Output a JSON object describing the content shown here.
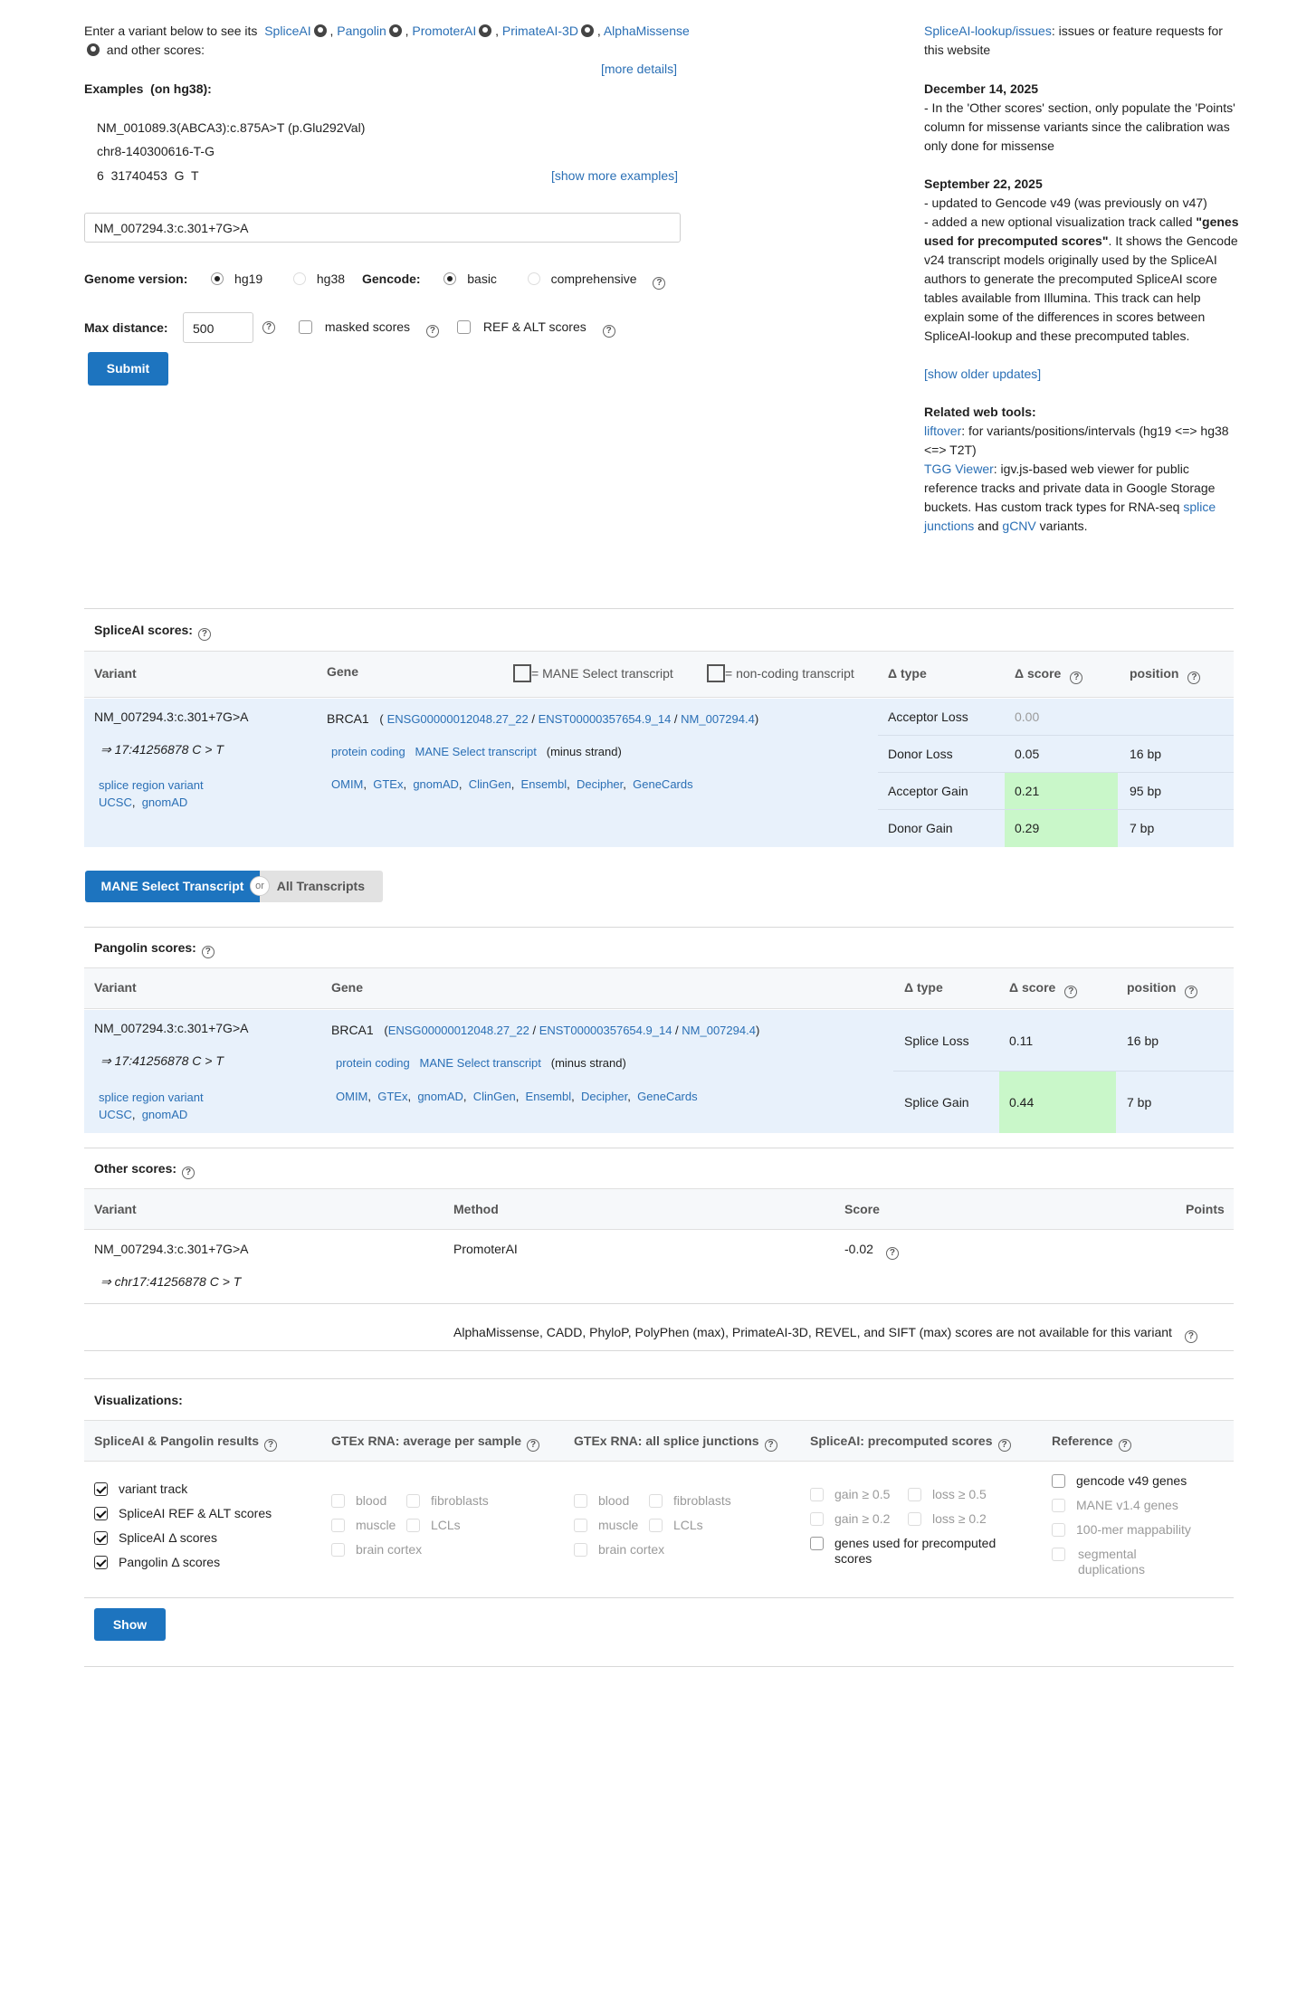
{
  "intro": {
    "prefix": "Enter a variant below to see its",
    "tools": [
      "SpliceAI",
      "Pangolin",
      "PromoterAI",
      "PrimateAI-3D",
      "AlphaMissense"
    ],
    "suffix": "and other scores:",
    "more_details": "[more details]"
  },
  "examples": {
    "heading": "Examples",
    "assembly": "(on hg38):",
    "items": [
      "NM_001089.3(ABCA3):c.875A>T (p.Glu292Val)",
      "chr8-140300616-T-G",
      "6  31740453  G  T"
    ],
    "show_more": "[show more examples]"
  },
  "search": {
    "value": "NM_007294.3:c.301+7G>A"
  },
  "options": {
    "genome_label": "Genome version:",
    "genome_options": [
      "hg19",
      "hg38"
    ],
    "genome_selected": "hg19",
    "gencode_label": "Gencode:",
    "gencode_options": [
      "basic",
      "comprehensive"
    ],
    "gencode_selected": "basic",
    "max_distance_label": "Max distance:",
    "max_distance_value": "500",
    "masked_label": "masked scores",
    "refalt_label": "REF & ALT scores",
    "submit_label": "Submit"
  },
  "news": {
    "issues_link": "SpliceAI-lookup/issues",
    "issues_text": ": issues or feature requests for this website",
    "updates": [
      {
        "date": "December 14, 2025",
        "lines": [
          "- In the 'Other scores' section, only populate the 'Points' column for missense variants since the calibration was only done for missense"
        ]
      },
      {
        "date": "September 22, 2025",
        "lines": [
          "- updated to Gencode v49 (was previously on v47)",
          "- added a new optional visualization track called"
        ],
        "bold": "\"genes used for precomputed scores\"",
        "after_bold": ". It shows the Gencode v24 transcript models originally used by the SpliceAI authors to generate the precomputed SpliceAI score tables available from Illumina. This track can help explain some of the differences in scores between SpliceAI-lookup and these precomputed tables."
      }
    ],
    "show_older": "[show older updates]",
    "related_heading": "Related web tools:",
    "liftover_link": "liftover",
    "liftover_text": ": for variants/positions/intervals (hg19 <=> hg38 <=> T2T)",
    "tgg_link": "TGG Viewer",
    "tgg_text": ": igv.js-based web viewer for public reference tracks and private data in Google Storage buckets. Has custom track types for RNA-seq",
    "splice_link": "splice junctions",
    "and_text": "and",
    "gcnv_link": "gCNV",
    "variants_text": "variants."
  },
  "spliceai": {
    "title": "SpliceAI scores:",
    "headers": {
      "variant": "Variant",
      "gene": "Gene",
      "mane_legend": "= MANE Select transcript",
      "noncoding_legend": "= non-coding transcript",
      "dtype": "Δ type",
      "dscore": "Δ score",
      "position": "position"
    },
    "variant": "NM_007294.3:c.301+7G>A",
    "coord": "⇒ 17:41256878 C > T",
    "consequence": "splice region variant",
    "ucsc": "UCSC",
    "gnomad": "gnomAD",
    "gene": "BRCA1",
    "ensg": "ENSG00000012048.27_22",
    "enst": "ENST00000357654.9_14",
    "nm": "NM_007294.4",
    "biotype": "protein coding",
    "mane": "MANE Select transcript",
    "strand": "(minus strand)",
    "gene_links": [
      "OMIM",
      "GTEx",
      "gnomAD",
      "ClinGen",
      "Ensembl",
      "Decipher",
      "GeneCards"
    ],
    "rows": [
      {
        "type": "Acceptor Loss",
        "score": "0.00",
        "position": ""
      },
      {
        "type": "Donor Loss",
        "score": "0.05",
        "position": "16 bp"
      },
      {
        "type": "Acceptor Gain",
        "score": "0.21",
        "position": "95 bp"
      },
      {
        "type": "Donor Gain",
        "score": "0.29",
        "position": "7 bp"
      }
    ]
  },
  "toggle": {
    "mane": "MANE Select Transcript",
    "or": "or",
    "all": "All Transcripts"
  },
  "pangolin": {
    "title": "Pangolin scores:",
    "headers": {
      "variant": "Variant",
      "gene": "Gene",
      "dtype": "Δ type",
      "dscore": "Δ score",
      "position": "position"
    },
    "variant": "NM_007294.3:c.301+7G>A",
    "coord": "⇒ 17:41256878 C > T",
    "consequence": "splice region variant",
    "ucsc": "UCSC",
    "gnomad": "gnomAD",
    "gene": "BRCA1",
    "ensg": "ENSG00000012048.27_22",
    "enst": "ENST00000357654.9_14",
    "nm": "NM_007294.4",
    "biotype": "protein coding",
    "mane": "MANE Select transcript",
    "strand": "(minus strand)",
    "gene_links": [
      "OMIM",
      "GTEx",
      "gnomAD",
      "ClinGen",
      "Ensembl",
      "Decipher",
      "GeneCards"
    ],
    "rows": [
      {
        "type": "Splice Loss",
        "score": "0.11",
        "position": "16 bp"
      },
      {
        "type": "Splice Gain",
        "score": "0.44",
        "position": "7 bp"
      }
    ]
  },
  "other": {
    "title": "Other scores:",
    "headers": {
      "variant": "Variant",
      "method": "Method",
      "score": "Score",
      "points": "Points"
    },
    "variant": "NM_007294.3:c.301+7G>A",
    "coord": "⇒ chr17:41256878 C > T",
    "method": "PromoterAI",
    "score": "-0.02",
    "unavailable": "AlphaMissense,  CADD,  PhyloP,  PolyPhen (max),  PrimateAI-3D,  REVEL,  and SIFT (max) scores are not available for this variant"
  },
  "viz": {
    "title": "Visualizations:",
    "col1": {
      "title": "SpliceAI & Pangolin results",
      "items": [
        "variant track",
        "SpliceAI REF & ALT scores",
        "SpliceAI Δ  scores",
        "Pangolin Δ  scores"
      ]
    },
    "col2": {
      "title": "GTEx RNA: average per sample",
      "items": [
        "blood",
        "fibroblasts",
        "muscle",
        "LCLs",
        "brain cortex"
      ]
    },
    "col3": {
      "title": "GTEx RNA: all splice junctions",
      "items": [
        "blood",
        "fibroblasts",
        "muscle",
        "LCLs",
        "brain cortex"
      ]
    },
    "col4": {
      "title": "SpliceAI: precomputed scores",
      "items": [
        "gain ≥ 0.5",
        "loss ≥ 0.5",
        "gain ≥ 0.2",
        "loss ≥ 0.2",
        "genes used for precomputed scores"
      ]
    },
    "col5": {
      "title": "Reference",
      "items": [
        "gencode v49 genes",
        "MANE v1.4 genes",
        "100-mer mappability",
        "segmental duplications"
      ]
    },
    "show_label": "Show"
  },
  "colors": {
    "link": "#2a6fb5",
    "button": "#1d74bf",
    "highlight": "#c9f7c9",
    "row_bg": "#e8f1fb"
  }
}
